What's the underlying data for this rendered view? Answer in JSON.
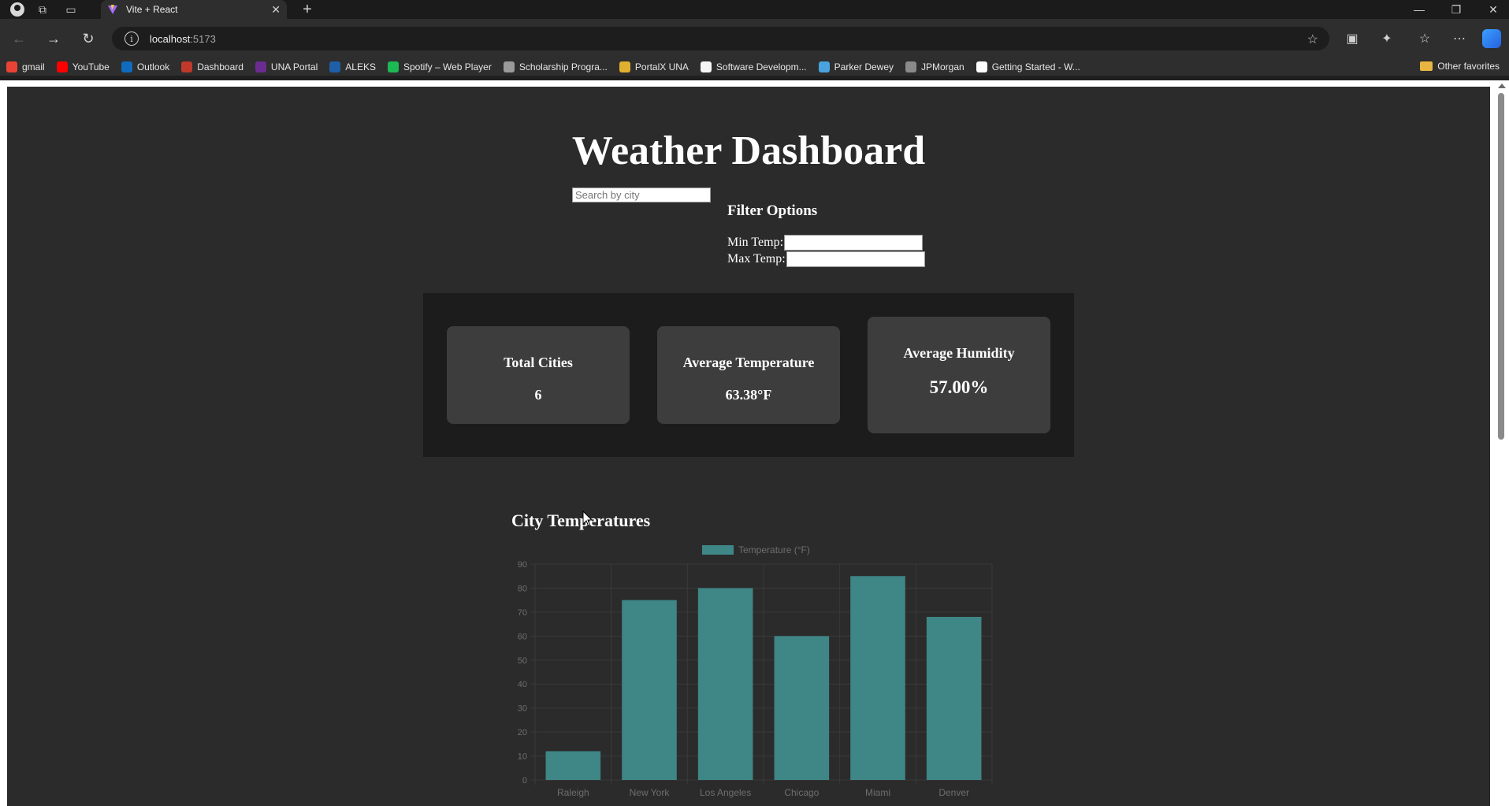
{
  "browser": {
    "tab_title": "Vite + React",
    "url_host": "localhost",
    "url_port": ":5173",
    "bookmarks": [
      {
        "label": "gmail",
        "color": "#ea4335"
      },
      {
        "label": "YouTube",
        "color": "#ff0000"
      },
      {
        "label": "Outlook",
        "color": "#0f6cbd"
      },
      {
        "label": "Dashboard",
        "color": "#c0392b"
      },
      {
        "label": "UNA Portal",
        "color": "#6a2c91"
      },
      {
        "label": "ALEKS",
        "color": "#1f5fa8"
      },
      {
        "label": "Spotify – Web Player",
        "color": "#1db954"
      },
      {
        "label": "Scholarship Progra...",
        "color": "#9a9a9a"
      },
      {
        "label": "PortalX UNA",
        "color": "#e0b030"
      },
      {
        "label": "Software Developm...",
        "color": "#f5f5f5"
      },
      {
        "label": "Parker Dewey",
        "color": "#4aa3df"
      },
      {
        "label": "JPMorgan",
        "color": "#8a8a8a"
      },
      {
        "label": "Getting Started - W...",
        "color": "#ffffff"
      }
    ],
    "other_favorites": "Other favorites"
  },
  "dashboard": {
    "title": "Weather Dashboard",
    "search_placeholder": "Search by city",
    "filter_title": "Filter Options",
    "min_temp_label": "Min Temp:",
    "max_temp_label": "Max Temp:",
    "stats": [
      {
        "label": "Total Cities",
        "value": "6"
      },
      {
        "label": "Average Temperature",
        "value": "63.38°F"
      },
      {
        "label": "Average Humidity",
        "value": "57.00%"
      }
    ],
    "chart_heading": "City Temperatures"
  },
  "colors": {
    "bar_fill": "#3f8686",
    "page_bg": "#2b2b2b",
    "card_bg": "#3d3d3d"
  },
  "chart_data": {
    "type": "bar",
    "categories": [
      "Raleigh",
      "New York",
      "Los Angeles",
      "Chicago",
      "Miami",
      "Denver"
    ],
    "series": [
      {
        "name": "Temperature (°F)",
        "values": [
          12,
          75,
          80,
          60,
          85,
          68
        ]
      }
    ],
    "ylim": [
      0,
      90
    ],
    "yticks": [
      0,
      10,
      20,
      30,
      40,
      50,
      60,
      70,
      80,
      90
    ],
    "legend": "top",
    "grid": true
  }
}
